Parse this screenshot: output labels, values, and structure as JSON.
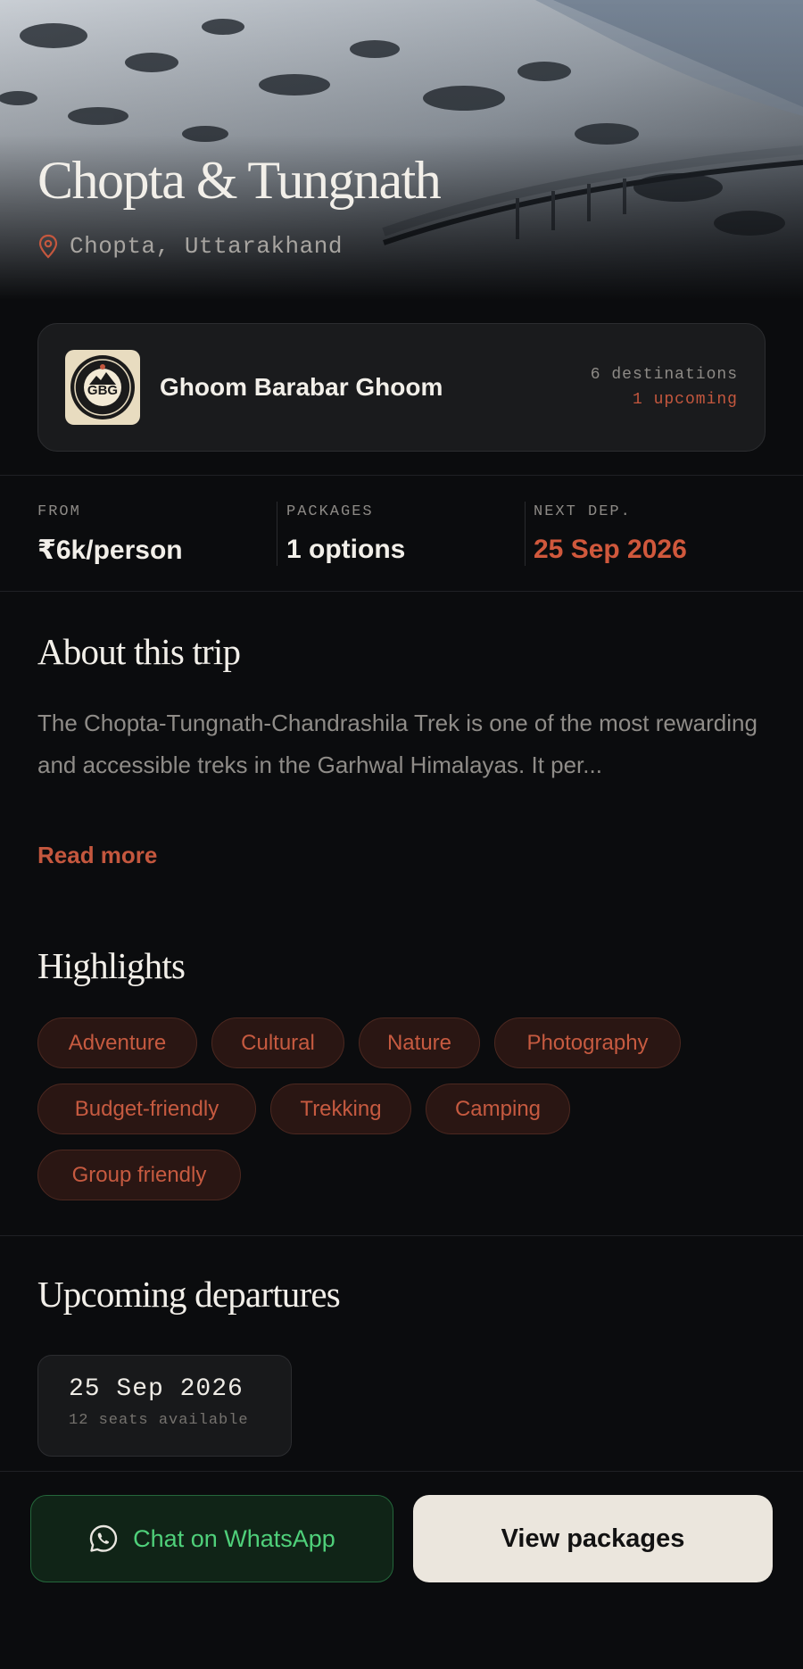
{
  "hero": {
    "title": "Chopta & Tungnath",
    "location": "Chopta, Uttarakhand"
  },
  "organizer": {
    "name": "Ghoom Barabar Ghoom",
    "destinations": "6 destinations",
    "upcoming": "1 upcoming",
    "logo_text": "GBG"
  },
  "stats": {
    "from_label": "FROM",
    "from_value": "₹6k/person",
    "packages_label": "PACKAGES",
    "packages_value": "1 options",
    "next_label": "NEXT DEP.",
    "next_value": "25 Sep 2026"
  },
  "about": {
    "title": "About this trip",
    "text": "The Chopta-Tungnath-Chandrashila Trek is one of the most rewarding and accessible treks in the Garhwal Himalayas. It per...",
    "read_more": "Read more"
  },
  "highlights": {
    "title": "Highlights",
    "tags": [
      "Adventure",
      "Cultural",
      "Nature",
      "Photography",
      "Budget-friendly",
      "Trekking",
      "Camping",
      "Group friendly"
    ]
  },
  "departures": {
    "title": "Upcoming departures",
    "items": [
      {
        "date": "25 Sep 2026",
        "seats": "12 seats available"
      }
    ]
  },
  "actions": {
    "whatsapp_label": "Chat on WhatsApp",
    "view_packages_label": "View packages"
  },
  "colors": {
    "background": "#0b0c0e",
    "accent": "#c4573e",
    "whatsapp_green": "#4fd07a",
    "primary_button": "#ebe6dd"
  },
  "icons": {
    "location": "map-pin-icon",
    "whatsapp": "whatsapp-icon"
  }
}
